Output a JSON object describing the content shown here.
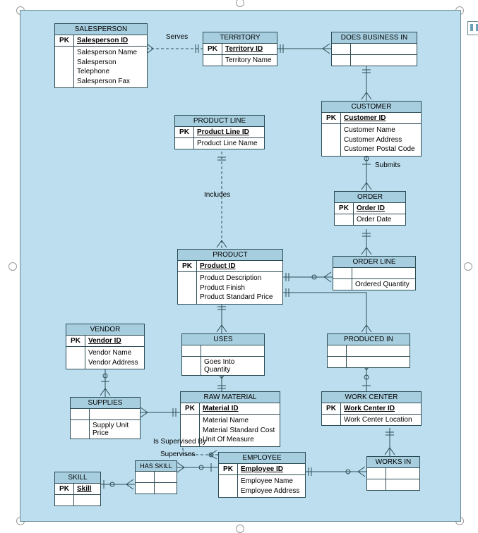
{
  "entities": {
    "salesperson": {
      "title": "SALESPERSON",
      "pk": "Salesperson ID",
      "attrs": [
        "Salesperson Name",
        "Salesperson Telephone",
        "Salesperson Fax"
      ]
    },
    "territory": {
      "title": "TERRITORY",
      "pk": "Territory ID",
      "attrs": [
        "Territory Name"
      ]
    },
    "does_business_in": {
      "title": "DOES BUSINESS IN"
    },
    "customer": {
      "title": "CUSTOMER",
      "pk": "Customer ID",
      "attrs": [
        "Customer Name",
        "Customer Address",
        "Customer Postal Code"
      ]
    },
    "product_line": {
      "title": "PRODUCT LINE",
      "pk": "Product Line ID",
      "attrs": [
        "Product Line Name"
      ]
    },
    "order": {
      "title": "ORDER",
      "pk": "Order ID",
      "attrs": [
        "Order Date"
      ]
    },
    "product": {
      "title": "PRODUCT",
      "pk": "Product ID",
      "attrs": [
        "Product Description",
        "Product Finish",
        "Product Standard Price"
      ]
    },
    "order_line": {
      "title": "ORDER LINE",
      "attrs": [
        "Ordered Quantity"
      ]
    },
    "vendor": {
      "title": "VENDOR",
      "pk": "Vendor ID",
      "attrs": [
        "Vendor Name",
        "Vendor Address"
      ]
    },
    "uses": {
      "title": "USES",
      "attrs": [
        "Goes Into Quantity"
      ]
    },
    "produced_in": {
      "title": "PRODUCED IN"
    },
    "supplies": {
      "title": "SUPPLIES",
      "attrs": [
        "Supply Unit Price"
      ]
    },
    "raw_material": {
      "title": "RAW MATERIAL",
      "pk": "Material ID",
      "attrs": [
        "Material Name",
        "Material Standard Cost",
        "Unit Of Measure"
      ]
    },
    "work_center": {
      "title": "WORK CENTER",
      "pk": "Work Center ID",
      "attrs": [
        "Work Center Location"
      ]
    },
    "employee": {
      "title": "EMPLOYEE",
      "pk": "Employee ID",
      "attrs": [
        "Employee Name",
        "Employee Address"
      ]
    },
    "works_in": {
      "title": "WORKS IN"
    },
    "skill": {
      "title": "SKILL",
      "pk": "Skill"
    },
    "has_skill": {
      "title": "HAS SKILL"
    }
  },
  "rel_labels": {
    "serves": "Serves",
    "includes": "Includes",
    "submits": "Submits",
    "is_supervised_by": "Is Supervised By",
    "supervises": "Supervises"
  },
  "pk_label": "PK"
}
